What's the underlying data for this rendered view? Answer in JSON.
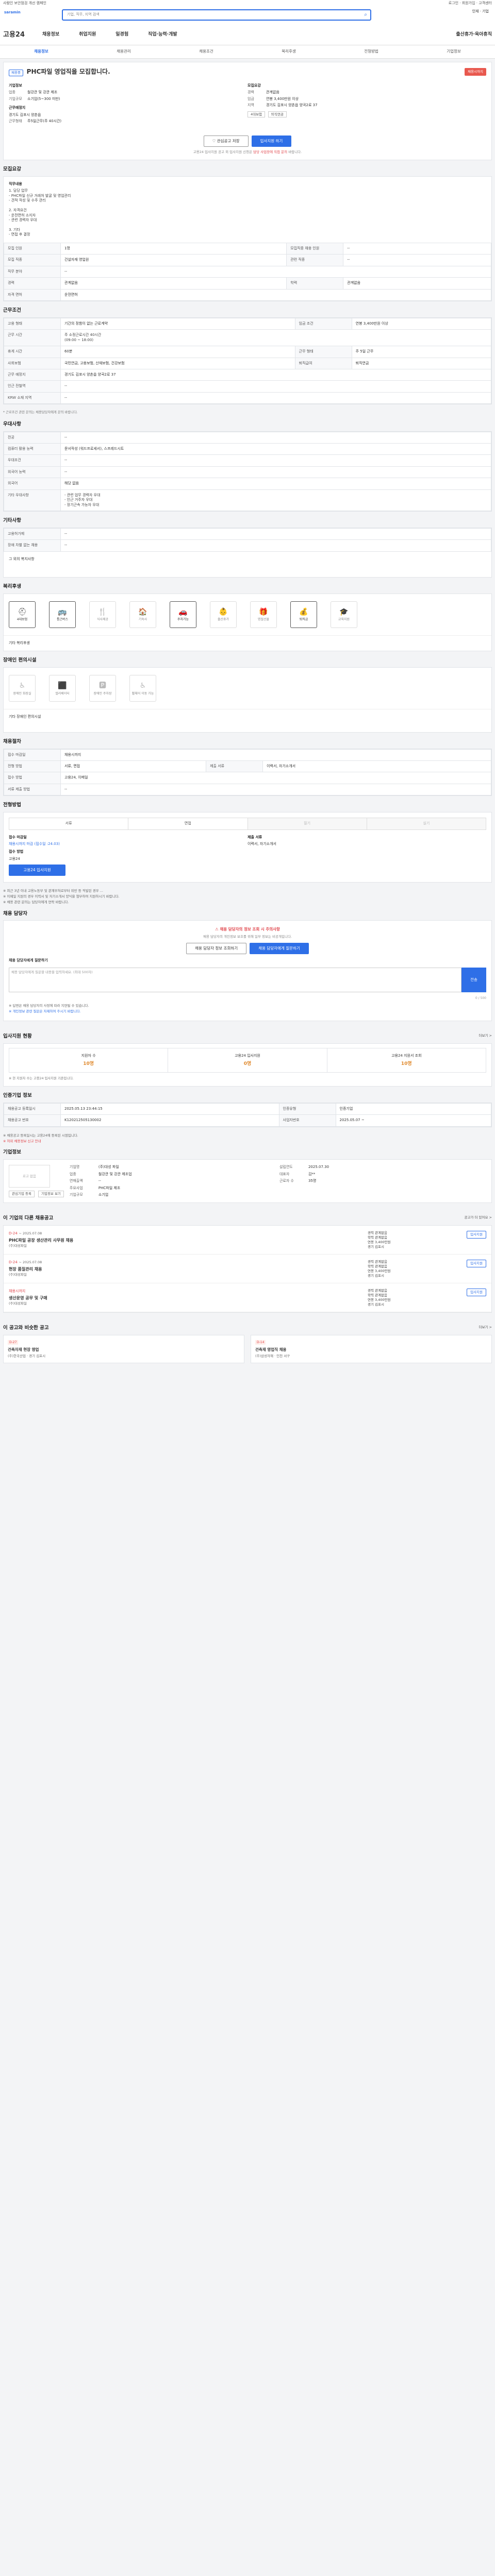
{
  "topbar": {
    "left": "사람인 보안점검 개선 캠페인",
    "right": "로그인 · 회원가입 · 고객센터"
  },
  "search": {
    "brand": "saramin",
    "placeholder": "기업, 직무, 지역 검색",
    "links": "인재 · 기업"
  },
  "gnb": {
    "logo": "고용24",
    "items": [
      "채용정보",
      "취업지원",
      "일경험",
      "직업·능력·개발",
      "출산휴가·육아휴직"
    ]
  },
  "tabs": [
    "채용정보",
    "채용관리",
    "채용조건",
    "복리후생",
    "전형방법",
    "기업정보"
  ],
  "job": {
    "status": "채용중",
    "title": "PHC파일 영업직을 모집합니다.",
    "stamp": "채용시까지",
    "company_label": "기업정보",
    "rows_left": [
      {
        "k": "업종",
        "v": "철강관 및 강관 제조"
      },
      {
        "k": "기업규모",
        "v": "소기업(5~300 미만)"
      }
    ],
    "workplace_label": "근무예정지",
    "workplace": "경기도 김포시 양촌읍",
    "salary_label": "모집요강",
    "rows_right": [
      {
        "k": "경력",
        "v": "관계없음"
      },
      {
        "k": "임금",
        "v": "연봉 3,400만원 이상"
      },
      {
        "k": "지역",
        "v": "경기도 김포시 양촌읍 양곡2로 37"
      }
    ],
    "shift": "근무형태",
    "shift_val": "주5일근무(주 40시간)",
    "chips": [
      "4대보험",
      "퇴직연금"
    ],
    "btn_save": "관심공고 저장",
    "btn_apply": "입사지원 하기",
    "note": "고용24 입사지원 공고 외 입사지원 신청은 ",
    "note_red": "담당 사업장에 직접 문의",
    "note_tail": " 바랍니다."
  },
  "duty": {
    "title": "모집요강",
    "duty_label": "직무내용",
    "duty_text": "1. 담당 업무\n- PHC파일 신규 거래처 발굴 및 영업관리\n- 견적 작성 및 수주 관리\n\n2. 자격요건\n- 운전면허 소지자\n- 관련 경력자 우대\n\n3. 기타\n- 면접 후 결정",
    "rows": [
      {
        "k": "모집 인원",
        "v": "1명",
        "k2": "모집직종 채용 인원",
        "v2": "--"
      },
      {
        "k": "모집 직종",
        "v": "건설자재 영업원",
        "k2": "관련 직종",
        "v2": "--"
      },
      {
        "k": "직무 분야",
        "v": "--",
        "k2": "",
        "v2": ""
      },
      {
        "k": "경력",
        "v": "관계없음",
        "k2": "학력",
        "v2": "관계없음"
      },
      {
        "k": "자격 면허",
        "v": "운전면허",
        "k2": "",
        "v2": ""
      }
    ]
  },
  "cond": {
    "title": "근무조건",
    "rows": [
      {
        "k": "고용 형태",
        "v": "기간의 정함이 없는 근로계약",
        "k2": "임금 조건",
        "v2": "연봉 3,400만원 이상"
      },
      {
        "k": "근무 시간",
        "v": "주 소정근로시간 40시간\n(09:00 ~ 18:00)",
        "k2": "",
        "v2": ""
      },
      {
        "k": "휴게 시간",
        "v": "60분",
        "k2": "근무 형태",
        "v2": "주 5일 근무"
      },
      {
        "k": "사회보험",
        "v": "국민연금, 고용보험, 산재보험, 건강보험",
        "k2": "퇴직급여",
        "v2": "퇴직연금"
      },
      {
        "k": "근무 예정지",
        "v": "경기도 김포시 양촌읍 양곡2로 37",
        "k2": "",
        "v2": ""
      },
      {
        "k": "인근 전철역",
        "v": "--",
        "k2": "",
        "v2": ""
      },
      {
        "k": "KRW 소재 지역",
        "v": "--",
        "k2": "",
        "v2": ""
      }
    ],
    "note": "* 근로조건 관련 문의는 채용담당자에게 문의 바랍니다."
  },
  "pref": {
    "title": "우대사항",
    "rows": [
      {
        "k": "전공",
        "v": "--"
      },
      {
        "k": "컴퓨터 활용 능력",
        "v": "문서작성 (워드프로세서), 스프레드시트"
      },
      {
        "k": "우대조건",
        "v": "--"
      },
      {
        "k": "외국어 능력",
        "v": "--"
      },
      {
        "k": "외국어",
        "v": "해당 없음"
      },
      {
        "k": "기타 우대사항",
        "v": "- 관련 업무 경력자 우대\n- 인근 거주자 우대\n- 장기근속 가능자 우대"
      }
    ]
  },
  "etc": {
    "title": "기타사항",
    "rows": [
      {
        "k": "고용허가제",
        "v": "--"
      },
      {
        "k": "장애 차별 없는 채용",
        "v": "--"
      }
    ],
    "note": "그 외의 복지사항"
  },
  "welfare": {
    "title": "복리후생",
    "items": [
      {
        "g": "⛑",
        "t": "4대보험",
        "on": true
      },
      {
        "g": "🚌",
        "t": "통근버스",
        "on": true
      },
      {
        "g": "🍴",
        "t": "식사제공",
        "on": false
      },
      {
        "g": "🏠",
        "t": "기숙사",
        "on": false
      },
      {
        "g": "🚗",
        "t": "주차가능",
        "on": true
      },
      {
        "g": "👶",
        "t": "출산휴가",
        "on": false
      },
      {
        "g": "🎁",
        "t": "명절선물",
        "on": false
      },
      {
        "g": "💰",
        "t": "퇴직금",
        "on": true
      },
      {
        "g": "🎓",
        "t": "교육지원",
        "on": false
      }
    ],
    "extra": "기타 복리후생"
  },
  "disab": {
    "title": "장애인 편의시설",
    "items": [
      {
        "g": "♿",
        "t": "장애인 화장실"
      },
      {
        "g": "⬛",
        "t": "엘리베이터"
      },
      {
        "g": "🅿",
        "t": "장애인 주차장"
      },
      {
        "g": "♿",
        "t": "휠체어 이동 가능"
      }
    ],
    "extra": "기타 장애인 편의시설"
  },
  "process": {
    "title": "채용절차",
    "rows": [
      {
        "k": "접수 마감일",
        "v": "채용시까지",
        "k2": "",
        "v2": ""
      },
      {
        "k": "전형 방법",
        "v": "서류, 면접",
        "k2": "제출 서류",
        "v2": "이력서, 자기소개서"
      },
      {
        "k": "접수 방법",
        "v": "고용24, 이메일",
        "k2": "",
        "v2": ""
      },
      {
        "k": "서류 제출 방법",
        "v": "--",
        "k2": "",
        "v2": ""
      }
    ]
  },
  "method": {
    "title": "전형방법",
    "tabs": [
      "서류",
      "면접",
      "필기",
      "실기"
    ],
    "reg": "접수 마감일",
    "reg_val": "채용시까지 마감 (접수일 : ",
    "reg_date": "24.03)",
    "way": "접수 방법",
    "way_val": "고용24",
    "docs": "제출 서류",
    "docs_val": "이력서, 자기소개서",
    "apply_btn": "고용24 입사지원",
    "notes": [
      "※ 최근 3년 이내 고용노동부 및 관계부처로부터 위반 등 적발된 경우 ...",
      "※ 이메일 지원의 경우 이력서 및 자기소개서 양식을 첨부하여 지원하시기 바랍니다.",
      "※ 채용 관련 문의는 담당자에게 연락 바랍니다."
    ]
  },
  "contact": {
    "title": "채용 담당자",
    "banner": "채용 담당자의 정보 조회 시 주의사항",
    "desc": "채용 담당자의 개인정보 보호를 위해 일부 정보는 비공개입니다.",
    "btn1": "채용 담당자 정보 조회하기",
    "btn2": "채용 담당자에게 질문하기",
    "q_label": "채용 담당자에게 질문하기",
    "q_placeholder": "채용 담당자에게 질문할 내용을 입력하세요. (최대 500자)",
    "q_send": "전송",
    "q_count": "0 / 500",
    "notes": [
      "※ 답변은 채용 담당자의 사정에 따라 지연될 수 있습니다.",
      "※ 개인정보 관련 질문은 자제하여 주시기 바랍니다."
    ]
  },
  "stats": {
    "title": "입사지원 현황",
    "more": "더보기 >",
    "items": [
      {
        "k": "지원자 수",
        "n": "10명"
      },
      {
        "k": "고용24 입사지원",
        "n": "0명"
      },
      {
        "k": "고용24 지원서 조회",
        "n": "10명"
      }
    ],
    "note": "※ 현 지원자 수는 고용24 입사지원 기준입니다."
  },
  "regist": {
    "title": "인증기업 정보",
    "rows": [
      {
        "k": "채용공고 등록일시",
        "v": "2025.05.13 23:44:15",
        "k2": "인증유형",
        "v2": "인증기업"
      },
      {
        "k": "채용공고 번호",
        "v": "K120212505130002",
        "k2": "사업자번호",
        "v2": "2025.05.07 ~"
      }
    ],
    "notes": [
      "※ 채용공고 등록일시는 고용24에 등록된 시점입니다.",
      "※ 허위 채용정보 신고 안내"
    ]
  },
  "corp": {
    "title": "기업정보",
    "logo": "로고 없음",
    "btn1": "관심기업 등록",
    "btn2": "기업정보 보기",
    "info": [
      {
        "k": "기업명",
        "v": "(주)대성 파일",
        "k2": "설립연도",
        "v2": "2025.07.30"
      },
      {
        "k": "업종",
        "v": "철강관 및 강관 제조업",
        "k2": "대표자",
        "v2": "김**"
      },
      {
        "k": "연매출액",
        "v": "--",
        "k2": "근로자 수",
        "v2": "35명"
      },
      {
        "k": "주요사업",
        "v": "PHC파일 제조",
        "k2": "",
        "v2": ""
      },
      {
        "k": "기업규모",
        "v": "소기업",
        "k2": "",
        "v2": ""
      }
    ]
  },
  "list": {
    "title": "이 기업의 다른 채용공고",
    "more": "공고가 더 있어요 >",
    "jobs": [
      {
        "dday": "D-24",
        "date": "~ 2025.07.08",
        "t": "PHC파일 공장 생산관리 사무원 채용",
        "s": "(주)대성파일",
        "m": [
          "경력 관계없음",
          "학력 관계없음",
          "연봉 3,400만원",
          "경기 김포시"
        ],
        "btn": "입사지원"
      },
      {
        "dday": "D-24",
        "date": "~ 2025.07.08",
        "t": "현장 품질관리 채용",
        "s": "(주)대성파일",
        "m": [
          "경력 관계없음",
          "학력 관계없음",
          "연봉 3,400만원",
          "경기 김포시"
        ],
        "btn": "입사지원"
      },
      {
        "dday": "채용시까지",
        "date": "",
        "t": "생산운영 공무 및 구매",
        "s": "(주)대성파일",
        "m": [
          "경력 관계없음",
          "학력 관계없음",
          "연봉 3,400만원",
          "경기 김포시"
        ],
        "btn": "입사지원"
      }
    ]
  },
  "rec": {
    "title": "이 공고와 비슷한 공고",
    "more": "더보기 >",
    "items": [
      {
        "b": "D-27",
        "t": "건축자재 현장 영업",
        "s": "(주)한국산업 · 경기 김포시"
      },
      {
        "b": "D-14",
        "t": "건축재 영업직 채용",
        "s": "(주)삼성자재 · 인천 서구"
      }
    ]
  }
}
